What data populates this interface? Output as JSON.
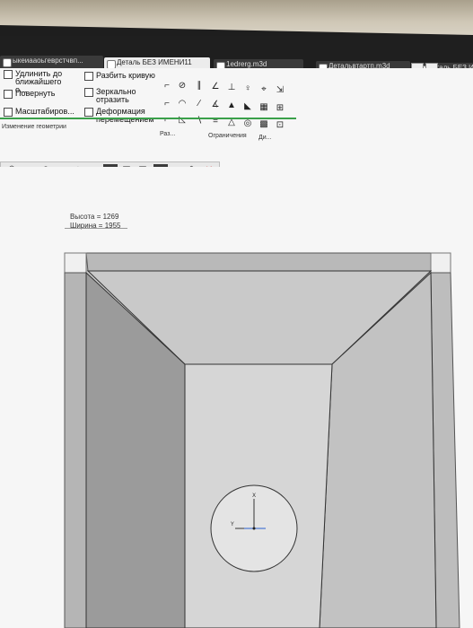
{
  "tabs": [
    {
      "label": "ыкеиааоьгеврстчвп...",
      "active": false
    },
    {
      "label": "Деталь БЕЗ ИМЕНИ11",
      "active": true
    },
    {
      "label": "1edrerg.m3d",
      "active": false
    },
    {
      "label": "Детальвтартп.m3d",
      "active": false
    },
    {
      "label": "Деталь БЕЗ И",
      "active": false
    }
  ],
  "ribbon": {
    "extend_label": "Удлинить до ближайшего о...",
    "rotate_label": "Повернуть",
    "scale_label": "Масштабиров...",
    "break_curve_label": "Разбить кривую",
    "mirror_label": "Зеркально отразить",
    "deform_label": "Деформация перемещением",
    "group_geometry": "Изменение геометрии",
    "group_ras": "Раз...",
    "group_constraints": "Ограничения",
    "group_di": "Ди..."
  },
  "drawing": {
    "height_text": "Высота = 1269",
    "width_text": "Ширина = 1955",
    "axis_x": "X",
    "axis_y": "Y"
  },
  "colors": {
    "accent_green": "#3aa04a",
    "model_face_light": "#d6d6d6",
    "model_face_dark": "#9d9d9d",
    "model_face_mid": "#c4c4c4"
  }
}
